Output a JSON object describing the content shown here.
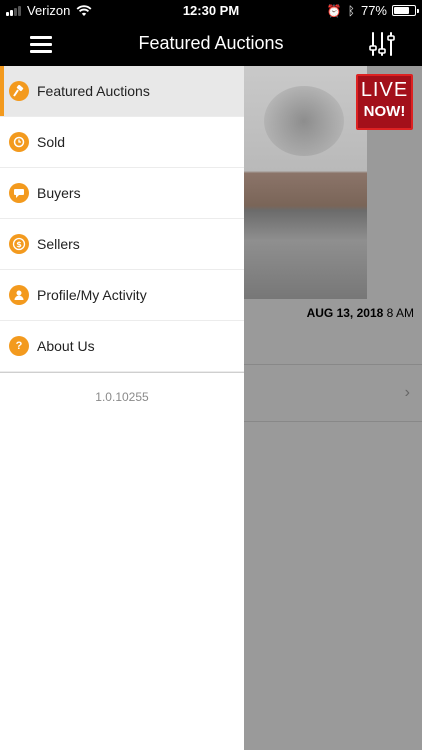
{
  "status_bar": {
    "carrier": "Verizon",
    "time": "12:30 PM",
    "battery_percent": "77%",
    "battery_level": 0.77
  },
  "nav": {
    "title": "Featured Auctions"
  },
  "drawer": {
    "items": [
      {
        "label": "Featured Auctions",
        "icon": "gavel-icon"
      },
      {
        "label": "Sold",
        "icon": "clock-icon"
      },
      {
        "label": "Buyers",
        "icon": "chat-icon"
      },
      {
        "label": "Sellers",
        "icon": "dollar-icon"
      },
      {
        "label": "Profile/My Activity",
        "icon": "user-icon"
      },
      {
        "label": "About Us",
        "icon": "question-icon"
      }
    ],
    "version": "1.0.10255"
  },
  "listing": {
    "live_line1": "LIVE",
    "live_line2": "NOW!",
    "date": "AUG 13, 2018",
    "time": "8 AM"
  },
  "colors": {
    "accent": "#f39a1e",
    "live_red": "#a3101a"
  }
}
